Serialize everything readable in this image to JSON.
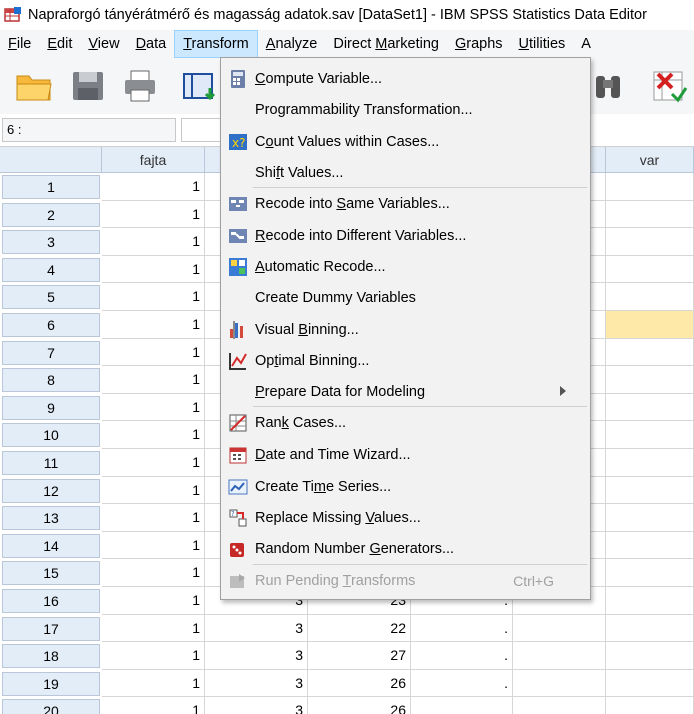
{
  "window": {
    "title": "Napraforgó tányérátmérő és magasság adatok.sav [DataSet1] - IBM SPSS Statistics Data Editor"
  },
  "menubar": {
    "items": [
      {
        "label": "File",
        "accel": "F",
        "rest": "ile"
      },
      {
        "label": "Edit",
        "accel": "E",
        "rest": "dit"
      },
      {
        "label": "View",
        "accel": "V",
        "rest": "iew"
      },
      {
        "label": "Data",
        "accel": "D",
        "rest": "ata"
      },
      {
        "label": "Transform",
        "accel": "T",
        "rest": "ransform"
      },
      {
        "label": "Analyze",
        "accel": "A",
        "rest": "nalyze"
      },
      {
        "label": "Direct Marketing",
        "pre": "Direct ",
        "accel": "M",
        "rest": "arketing"
      },
      {
        "label": "Graphs",
        "accel": "G",
        "rest": "raphs"
      },
      {
        "label": "Utilities",
        "accel": "U",
        "rest": "tilities"
      },
      {
        "label": "A"
      }
    ],
    "active": "Transform"
  },
  "cell_ref": "6 :",
  "grid": {
    "headers": [
      "fajta",
      "",
      "",
      "",
      "",
      "var"
    ],
    "rows": [
      {
        "n": "1",
        "a": "1",
        "b": "",
        "c": "",
        "d": ""
      },
      {
        "n": "2",
        "a": "1",
        "b": "",
        "c": "",
        "d": ""
      },
      {
        "n": "3",
        "a": "1",
        "b": "",
        "c": "",
        "d": ""
      },
      {
        "n": "4",
        "a": "1",
        "b": "",
        "c": "",
        "d": ""
      },
      {
        "n": "5",
        "a": "1",
        "b": "",
        "c": "",
        "d": ""
      },
      {
        "n": "6",
        "a": "1",
        "b": "",
        "c": "",
        "d": ""
      },
      {
        "n": "7",
        "a": "1",
        "b": "",
        "c": "",
        "d": ""
      },
      {
        "n": "8",
        "a": "1",
        "b": "",
        "c": "",
        "d": ""
      },
      {
        "n": "9",
        "a": "1",
        "b": "",
        "c": "",
        "d": ""
      },
      {
        "n": "10",
        "a": "1",
        "b": "",
        "c": "",
        "d": ""
      },
      {
        "n": "11",
        "a": "1",
        "b": "",
        "c": "",
        "d": ""
      },
      {
        "n": "12",
        "a": "1",
        "b": "",
        "c": "",
        "d": ""
      },
      {
        "n": "13",
        "a": "1",
        "b": "",
        "c": "",
        "d": ""
      },
      {
        "n": "14",
        "a": "1",
        "b": "",
        "c": "",
        "d": ""
      },
      {
        "n": "15",
        "a": "1",
        "b": "",
        "c": "",
        "d": ""
      },
      {
        "n": "16",
        "a": "1",
        "b": "3",
        "c": "23",
        "d": "."
      },
      {
        "n": "17",
        "a": "1",
        "b": "3",
        "c": "22",
        "d": "."
      },
      {
        "n": "18",
        "a": "1",
        "b": "3",
        "c": "27",
        "d": "."
      },
      {
        "n": "19",
        "a": "1",
        "b": "3",
        "c": "26",
        "d": "."
      },
      {
        "n": "20",
        "a": "1",
        "b": "3",
        "c": "26",
        "d": ""
      }
    ]
  },
  "transform_menu": {
    "items": [
      {
        "icon": "compute-variable-icon",
        "pre": "",
        "accel": "C",
        "rest": "ompute Variable..."
      },
      {
        "icon": "",
        "pre": "Programmability Transformation...",
        "accel": "",
        "rest": ""
      },
      {
        "icon": "count-values-icon",
        "pre": "C",
        "accel": "o",
        "rest": "unt Values within Cases..."
      },
      {
        "icon": "",
        "pre": "Shi",
        "accel": "f",
        "rest": "t Values..."
      },
      {
        "icon": "recode-same-icon",
        "pre": "Recode into ",
        "accel": "S",
        "rest": "ame Variables..."
      },
      {
        "icon": "recode-different-icon",
        "pre": "",
        "accel": "R",
        "rest": "ecode into Different Variables..."
      },
      {
        "icon": "automatic-recode-icon",
        "pre": "",
        "accel": "A",
        "rest": "utomatic Recode..."
      },
      {
        "icon": "",
        "pre": "Create Dummy Variables",
        "accel": "",
        "rest": ""
      },
      {
        "icon": "visual-binning-icon",
        "pre": "Visual ",
        "accel": "B",
        "rest": "inning..."
      },
      {
        "icon": "optimal-binning-icon",
        "pre": "Op",
        "accel": "t",
        "rest": "imal Binning..."
      },
      {
        "icon": "",
        "pre": "",
        "accel": "P",
        "rest": "repare Data for Modeling",
        "submenu": true
      },
      {
        "icon": "rank-cases-icon",
        "pre": "Ran",
        "accel": "k",
        "rest": " Cases..."
      },
      {
        "icon": "date-time-wizard-icon",
        "pre": "",
        "accel": "D",
        "rest": "ate and Time Wizard..."
      },
      {
        "icon": "time-series-icon",
        "pre": "Create Ti",
        "accel": "m",
        "rest": "e Series..."
      },
      {
        "icon": "replace-missing-icon",
        "pre": "Replace Missing ",
        "accel": "V",
        "rest": "alues..."
      },
      {
        "icon": "random-number-icon",
        "pre": "Random Number ",
        "accel": "G",
        "rest": "enerators..."
      },
      {
        "icon": "run-pending-icon",
        "pre": "Run Pending ",
        "accel": "T",
        "rest": "ransforms",
        "shortcut": "Ctrl+G",
        "disabled": true
      }
    ]
  },
  "colors": {
    "selection": "#cce8ff",
    "row_header": "#e3edf8",
    "active_cell": "#ffe9a8",
    "menu_bg": "#f2f2f2"
  }
}
